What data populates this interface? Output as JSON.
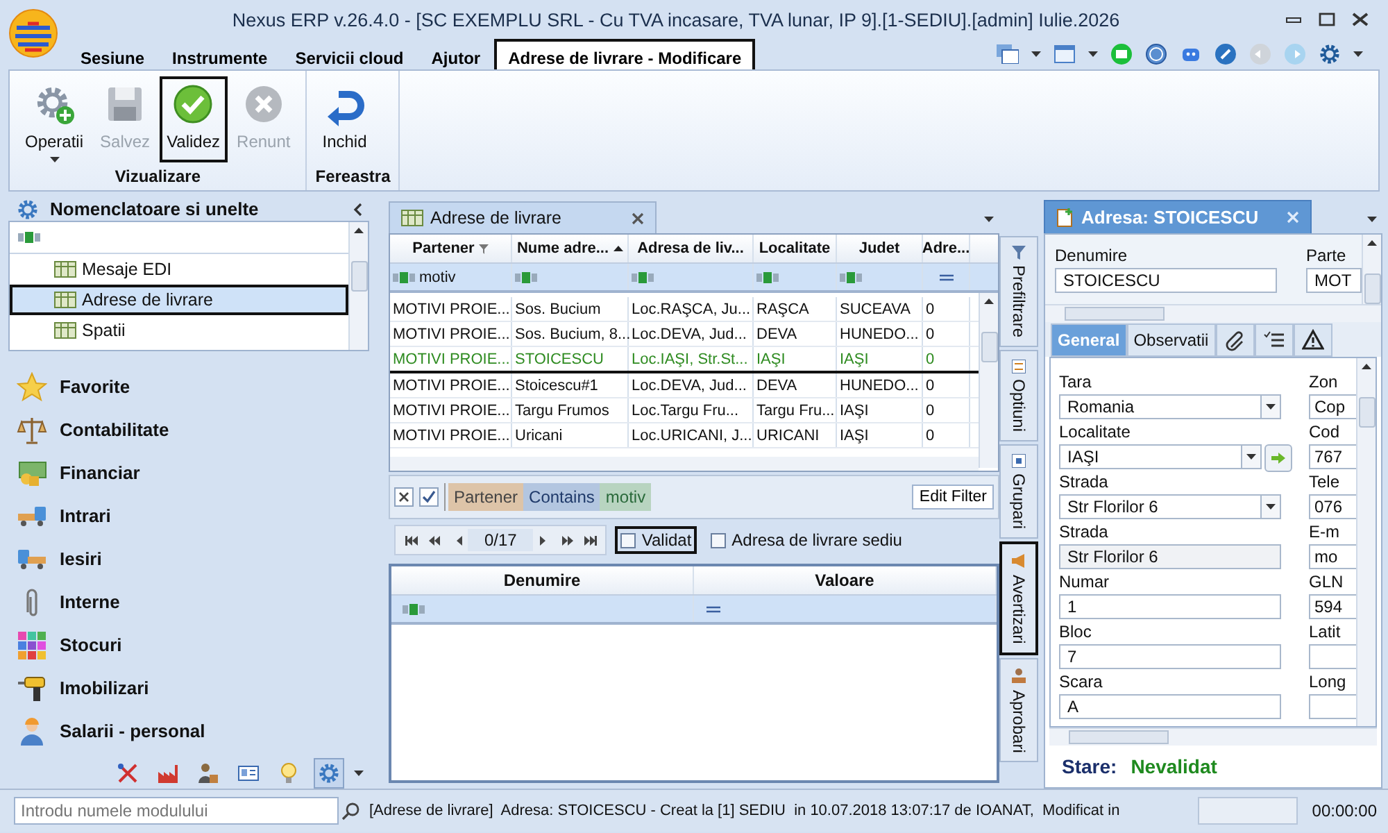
{
  "window": {
    "title": "Nexus ERP v.26.4.0 - [SC EXEMPLU SRL - Cu TVA incasare, TVA lunar, IP 9].[1-SEDIU].[admin] Iulie.2026"
  },
  "menu": [
    {
      "label": "Sesiune",
      "selected": false
    },
    {
      "label": "Instrumente",
      "selected": false
    },
    {
      "label": "Servicii cloud",
      "selected": false
    },
    {
      "label": "Ajutor",
      "selected": false
    },
    {
      "label": "Adrese de livrare - Modificare",
      "selected": true
    }
  ],
  "ribbon": {
    "groups": [
      {
        "label": "Vizualizare",
        "buttons": [
          {
            "label": "Operatii",
            "disabled": false,
            "focused": false,
            "dropdown": true
          },
          {
            "label": "Salvez",
            "disabled": true,
            "focused": false
          },
          {
            "label": "Validez",
            "disabled": false,
            "focused": true
          },
          {
            "label": "Renunt",
            "disabled": true,
            "focused": false
          }
        ]
      },
      {
        "label": "Fereastra",
        "buttons": [
          {
            "label": "Inchid",
            "disabled": false,
            "focused": false
          }
        ]
      }
    ]
  },
  "navigator": {
    "title": "Nomenclatoare si unelte",
    "tree": [
      {
        "label": "Mesaje EDI",
        "selected": false
      },
      {
        "label": "Adrese de livrare",
        "selected": true
      },
      {
        "label": "Spatii",
        "selected": false
      }
    ],
    "modules": [
      {
        "label": "Favorite"
      },
      {
        "label": "Contabilitate"
      },
      {
        "label": "Financiar"
      },
      {
        "label": "Intrari"
      },
      {
        "label": "Iesiri"
      },
      {
        "label": "Interne"
      },
      {
        "label": "Stocuri"
      },
      {
        "label": "Imobilizari"
      },
      {
        "label": "Salarii - personal"
      }
    ],
    "shortcuts": [
      {
        "selected": false
      },
      {
        "selected": false
      },
      {
        "selected": false
      },
      {
        "selected": false
      },
      {
        "selected": false
      },
      {
        "selected": true
      }
    ],
    "search": {
      "placeholder": "Introdu numele modulului"
    }
  },
  "document_tab": {
    "label": "Adrese de livrare"
  },
  "grid": {
    "columns": [
      {
        "label": "Partener",
        "kind": "text",
        "filtered": true,
        "filter": "motiv"
      },
      {
        "label": "Nume adre...",
        "kind": "text",
        "sorted": true
      },
      {
        "label": "Adresa de liv...",
        "kind": "text"
      },
      {
        "label": "Localitate",
        "kind": "text"
      },
      {
        "label": "Judet",
        "kind": "text"
      },
      {
        "label": "Adre...",
        "kind": "number"
      }
    ],
    "rows": [
      {
        "selected": false,
        "cells": [
          "MOTIVI PROIE...",
          "Sos. Bucium",
          "Loc.RAŞCA, Ju...",
          "RAŞCA",
          "SUCEAVA",
          "0"
        ]
      },
      {
        "selected": false,
        "cells": [
          "MOTIVI PROIE...",
          "Sos. Bucium, 8...",
          "Loc.DEVA, Jud...",
          "DEVA",
          "HUNEDO...",
          "0"
        ]
      },
      {
        "selected": true,
        "cells": [
          "MOTIVI PROIE...",
          "STOICESCU",
          "Loc.IAŞI, Str.St...",
          "IAŞI",
          "IAŞI",
          "0"
        ]
      },
      {
        "selected": false,
        "cells": [
          "MOTIVI PROIE...",
          "Stoicescu#1",
          "Loc.DEVA, Jud...",
          "DEVA",
          "HUNEDO...",
          "0"
        ]
      },
      {
        "selected": false,
        "cells": [
          "MOTIVI PROIE...",
          "Targu Frumos",
          "Loc.Targu Fru...",
          "Targu Fru...",
          "IAŞI",
          "0"
        ]
      },
      {
        "selected": false,
        "cells": [
          "MOTIVI PROIE...",
          "Uricani",
          "Loc.URICANI, J...",
          "URICANI",
          "IAŞI",
          "0"
        ]
      }
    ]
  },
  "filter_bar": {
    "enabled": true,
    "field": "Partener",
    "operator": "Contains",
    "value": "motiv",
    "edit_button": "Edit Filter"
  },
  "pager": {
    "position": "0/17"
  },
  "options": [
    {
      "label": "Validat",
      "checked": false,
      "focused": true
    },
    {
      "label": "Adresa de livrare sediu",
      "checked": false,
      "focused": false
    }
  ],
  "properties_grid": {
    "columns": [
      {
        "label": "Denumire",
        "kind": "text"
      },
      {
        "label": "Valoare",
        "kind": "number"
      }
    ]
  },
  "side_tabs": [
    {
      "label": "Prefiltrare",
      "selected": false
    },
    {
      "label": "Optiuni",
      "selected": false
    },
    {
      "label": "Grupari",
      "selected": false
    },
    {
      "label": "Avertizari",
      "selected": true
    },
    {
      "label": "Aprobari",
      "selected": false
    }
  ],
  "detail": {
    "title": "Adresa: STOICESCU",
    "header_fields": [
      {
        "label": "Denumire",
        "value": "STOICESCU"
      },
      {
        "label": "Parte",
        "value": "MOT"
      }
    ],
    "tabs": [
      {
        "kind": "text",
        "label": "General",
        "selected": true
      },
      {
        "kind": "text",
        "label": "Observatii",
        "selected": false
      },
      {
        "kind": "icon",
        "selected": false
      },
      {
        "kind": "icon",
        "selected": false
      },
      {
        "kind": "icon",
        "selected": false
      }
    ],
    "fields_left": [
      {
        "label": "Tara",
        "value": "Romania",
        "kind": "combo"
      },
      {
        "label": "Localitate",
        "value": "IAŞI",
        "kind": "combo_link"
      },
      {
        "label": "Strada",
        "value": "Str Florilor 6",
        "kind": "combo"
      },
      {
        "label": "Strada",
        "value": "Str Florilor 6",
        "kind": "readonly"
      },
      {
        "label": "Numar",
        "value": "1",
        "kind": "text"
      },
      {
        "label": "Bloc",
        "value": "7",
        "kind": "text"
      },
      {
        "label": "Scara",
        "value": "A",
        "kind": "text"
      }
    ],
    "fields_right": [
      {
        "label": "Zon",
        "value": "Cop"
      },
      {
        "label": "Cod",
        "value": "767"
      },
      {
        "label": "Tele",
        "value": "076"
      },
      {
        "label": "E-m",
        "value": "mo"
      },
      {
        "label": "GLN",
        "value": "594"
      },
      {
        "label": "Latit"
      },
      {
        "label": "Long"
      }
    ],
    "status_label": "Stare:",
    "status_value": "Nevalidat"
  },
  "status_bar": {
    "message": "[Adrese de livrare]  Adresa: STOICESCU - Creat la [1] SEDIU  in 10.07.2018 13:07:17 de IOANAT,  Modificat in",
    "time": "00:00:00"
  }
}
